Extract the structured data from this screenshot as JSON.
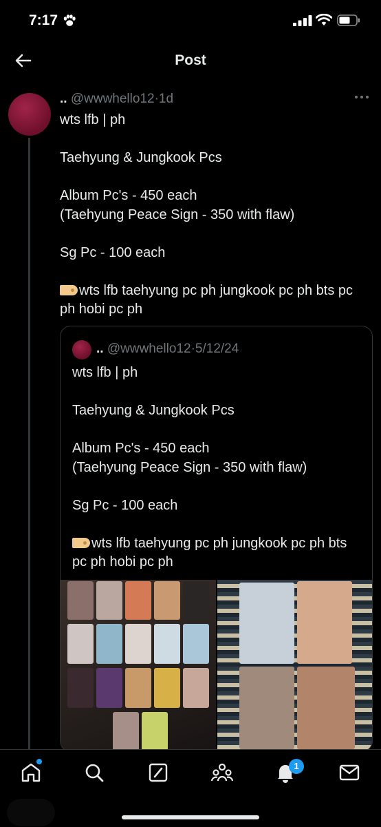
{
  "status_bar": {
    "time": "7:17"
  },
  "header": {
    "title": "Post"
  },
  "post": {
    "display_name": "..",
    "handle": "@wwwhello12",
    "separator": "·",
    "time": "1d",
    "lines": [
      "wts lfb | ph",
      "",
      "Taehyung & Jungkook Pcs",
      "",
      "Album Pc's - 450 each",
      "(Taehyung Peace Sign - 350 with flaw)",
      "",
      "Sg Pc - 100 each",
      ""
    ],
    "tag_line": "wts lfb taehyung pc ph jungkook pc ph bts pc ph hobi pc ph"
  },
  "quoted_post": {
    "display_name": "..",
    "handle": "@wwwhello12",
    "separator": "·",
    "date": "5/12/24",
    "lines": [
      "wts lfb | ph",
      "",
      "Taehyung & Jungkook Pcs",
      "",
      "Album Pc's - 450 each",
      "(Taehyung Peace Sign - 350 with flaw)",
      "",
      "Sg Pc - 100 each",
      ""
    ],
    "tag_line": "wts lfb taehyung pc ph jungkook pc ph bts pc ph hobi pc ph"
  },
  "tab_bar": {
    "items": [
      "home-icon",
      "search-icon",
      "grok-icon",
      "communities-icon",
      "notifications-icon",
      "messages-icon"
    ],
    "notification_count": "1"
  },
  "colors": {
    "accent": "#1d9bf0",
    "background": "#000000",
    "muted": "#71767b",
    "text": "#e7e9ea"
  }
}
